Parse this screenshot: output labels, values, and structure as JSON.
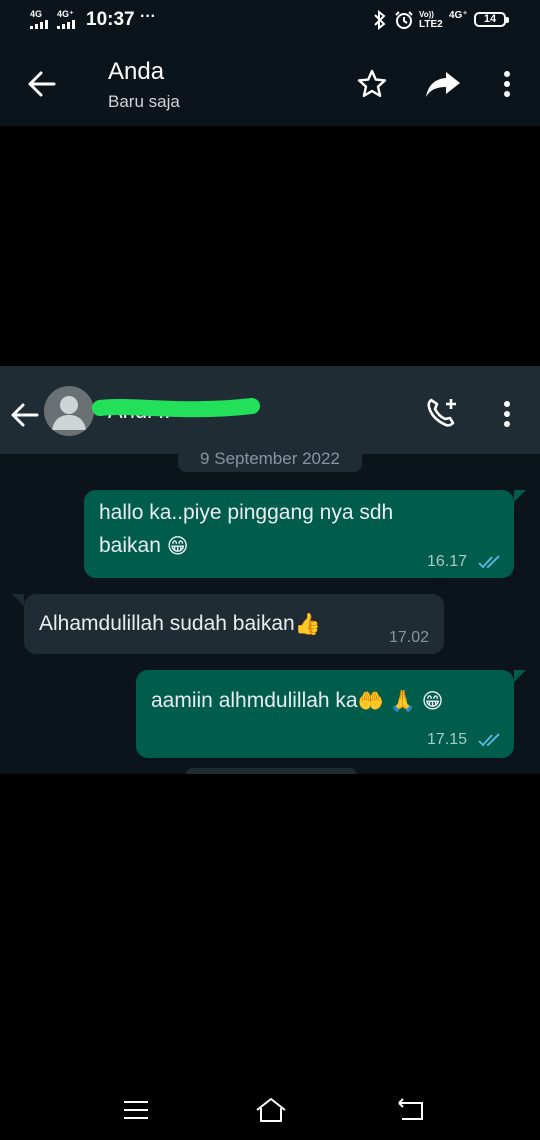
{
  "status_bar": {
    "net1": "4G",
    "net2": "4G⁺",
    "time": "10:37",
    "more": "···",
    "volte_top": "Vo))",
    "volte_bottom": "LTE2",
    "net3": "4G⁺",
    "battery": "14"
  },
  "viewer": {
    "title": "Anda",
    "subtitle": "Baru saja"
  },
  "chat": {
    "contact_name": "Andi ..",
    "date_separator": "9 September 2022",
    "messages": [
      {
        "direction": "outgoing",
        "text_line1": "hallo ka..piye pinggang nya sdh",
        "text_line2": "baikan",
        "emoji": "😁",
        "time": "16.17",
        "status": "read"
      },
      {
        "direction": "incoming",
        "text": "Alhamdulillah sudah baikan",
        "emoji": "👍",
        "time": "17.02"
      },
      {
        "direction": "outgoing",
        "text": "aamiin alhmdulillah ka",
        "emoji1": "🤲",
        "emoji2": "🙏",
        "emoji3": "😁",
        "time": "17.15",
        "status": "read"
      }
    ]
  },
  "colors": {
    "outgoing_bubble": "#005c4b",
    "incoming_bubble": "#1f2c34",
    "read_ticks": "#53bdeb",
    "redaction": "#22e05a"
  },
  "icons": {
    "back": "arrow-left-icon",
    "star": "star-outline-icon",
    "forward": "forward-arrow-icon",
    "more": "more-vertical-icon",
    "add_call": "add-call-icon",
    "avatar": "default-avatar-icon"
  }
}
